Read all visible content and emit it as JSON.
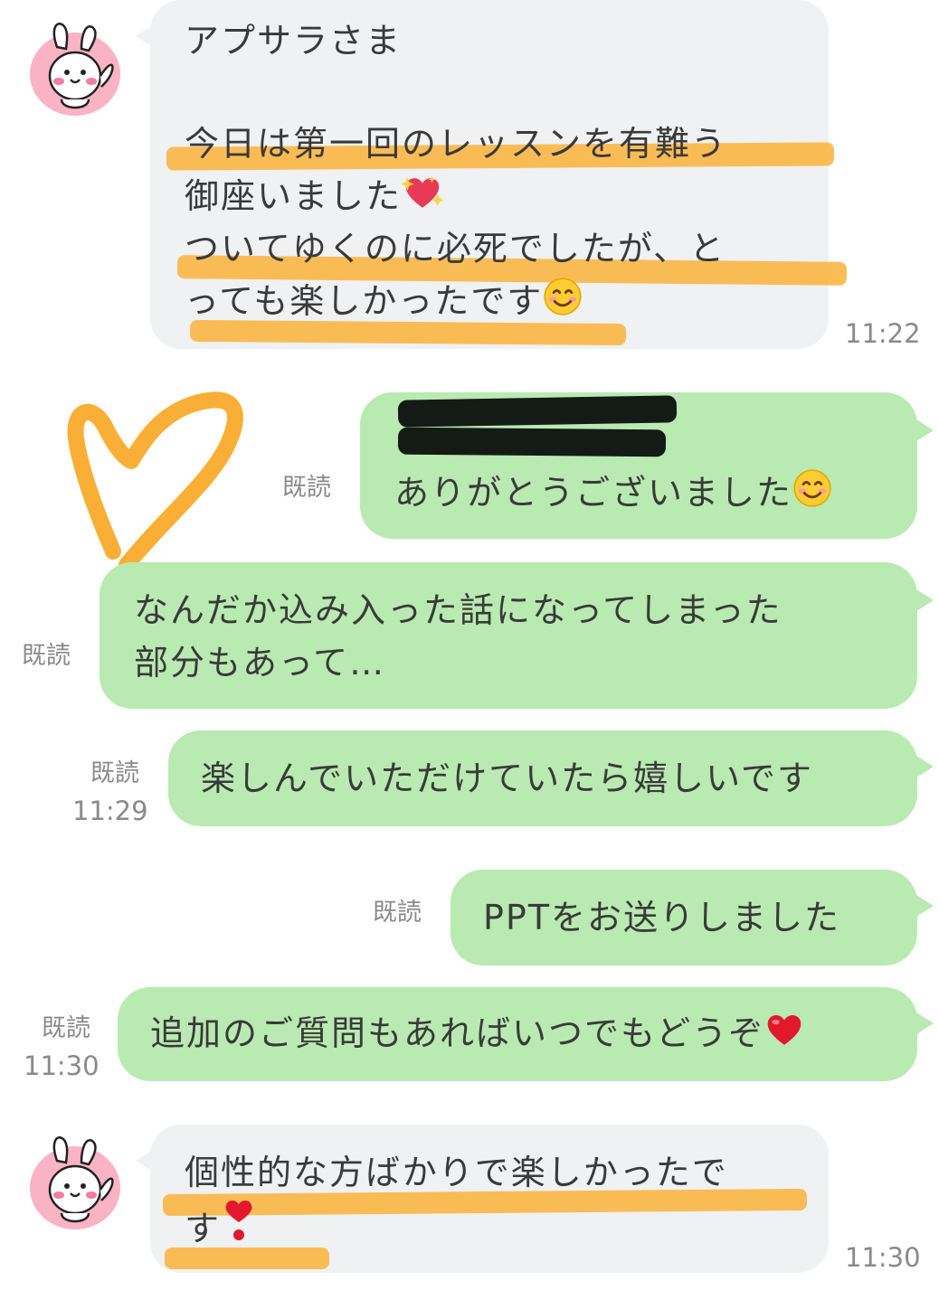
{
  "messages": {
    "m1": {
      "line1": "アプサラさま",
      "line2": "今日は第一回のレッスンを有難う",
      "line3": "御座いました",
      "line4": "ついてゆくのに必死でしたが、と",
      "line5": "っても楽しかったです",
      "time": "11:22"
    },
    "m2": {
      "text": "ありがとうございました",
      "read": "既読"
    },
    "m3": {
      "line1": "なんだか込み入った話になってしまった",
      "line2": "部分もあって…",
      "read": "既読"
    },
    "m4": {
      "text": "楽しんでいただけていたら嬉しいです",
      "read": "既読",
      "time": "11:29"
    },
    "m5": {
      "text": "PPTをお送りしました",
      "read": "既読"
    },
    "m6": {
      "text": "追加のご質問もあればいつでもどうぞ",
      "read": "既読",
      "time": "11:30"
    },
    "m7": {
      "line1": "個性的な方ばかりで楽しかったで",
      "line2": "す",
      "time": "11:30"
    }
  },
  "icons": {
    "avatar": "pink-rabbit-sticker-avatar",
    "sparkle_heart": "sparkling-heart-icon",
    "smile": "smiling-face-icon",
    "heart": "red-heart-icon",
    "exclamation_heart": "heart-exclamation-icon"
  },
  "colors": {
    "incoming_bubble": "#f0f1f3",
    "outgoing_bubble": "#b9eab1",
    "highlight": "#f9b233",
    "meta_text": "#8a8a8a"
  }
}
